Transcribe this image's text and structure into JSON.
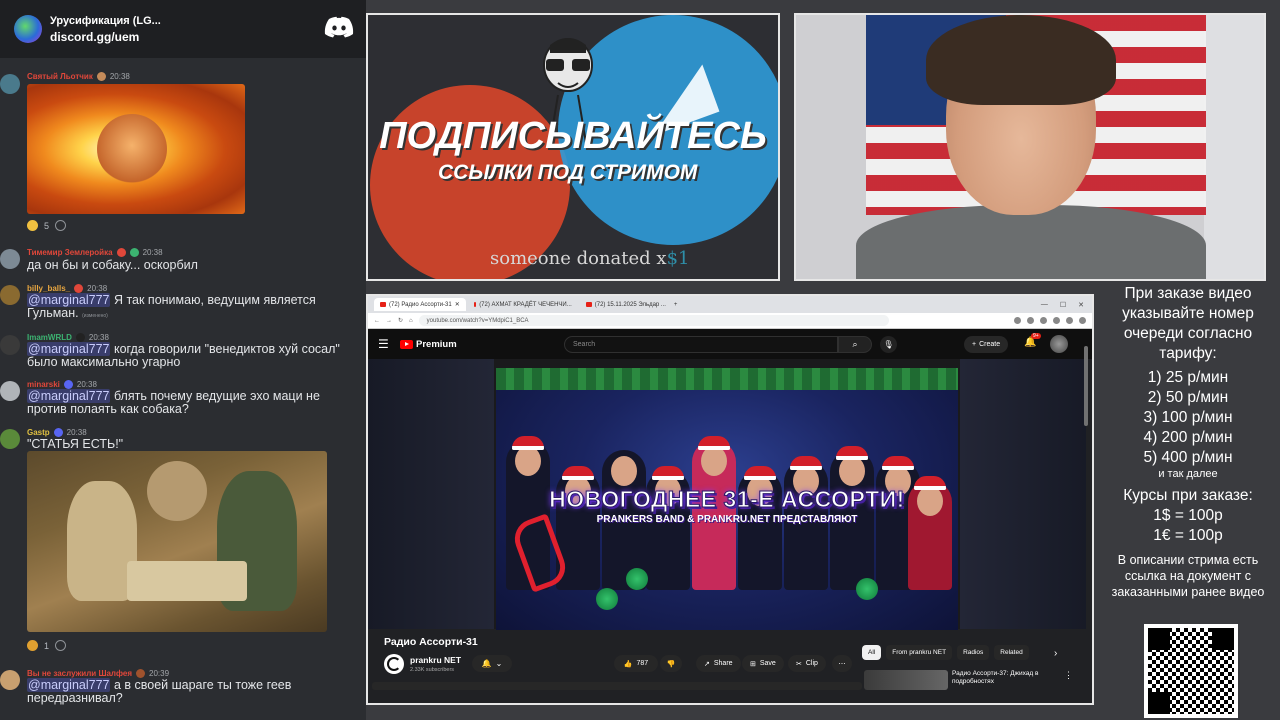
{
  "chat": {
    "server_name": "Урусификация (LG...",
    "invite": "discord.gg/uem",
    "messages": [
      {
        "user": "Святый Льотчик",
        "time": "20:38",
        "user_color": "#e0473a",
        "reactions": [
          {
            "count": "5"
          }
        ]
      },
      {
        "user": "Тимемир Землеройка",
        "time": "20:38",
        "user_color": "#e0473a",
        "text": "да он бы и собаку... оскорбил"
      },
      {
        "user": "billy_balls_",
        "time": "20:38",
        "user_color": "#e8a640",
        "mention": "@marginal777",
        "text": " Я так понимаю, ведущим является Гульман.",
        "note": "(изменено)"
      },
      {
        "user": "ImamWRLD",
        "time": "20:38",
        "user_color": "#3cb371",
        "mention": "@marginal777",
        "text": " когда говорили \"венедиктов хуй сосал\" было максимально угарно"
      },
      {
        "user": "minarski",
        "time": "20:38",
        "user_color": "#e0473a",
        "mention": "@marginal777",
        "text": " блять почему ведущие эхо маци не против полаять как собака?"
      },
      {
        "user": "Gastp",
        "time": "20:38",
        "user_color": "#e0c040",
        "text": "\"СТАТЬЯ ЕСТЬ!\"",
        "reactions": [
          {
            "count": "1"
          }
        ]
      },
      {
        "user": "Вы не заслужили Шалфея",
        "time": "20:39",
        "user_color": "#e0473a",
        "mention": "@marginal777",
        "text": " а в своей шараге ты тоже геев передразнивал?"
      }
    ]
  },
  "promo": {
    "title": "ПОДПИСЫВАЙТЕСЬ",
    "subtitle": "ССЫЛКИ ПОД СТРИМОМ",
    "donate_prefix": "someone donated x",
    "donate_amount": "$1"
  },
  "browser": {
    "tabs": [
      "(72) Радио Ассорти-31",
      "(72) АХМАТ КРАДЁТ ЧЕЧЕНЧИ...",
      "(72) 15.11.2025 Эльдар ..."
    ],
    "url": "youtube.com/watch?v=YMdpiC1_BCA"
  },
  "youtube": {
    "logo_text": "Premium",
    "search_placeholder": "Search",
    "create_label": "Create",
    "notif_count": "9+",
    "thumb_title": "НОВОГОДНЕЕ 31-Е АССОРТИ!",
    "thumb_subtitle": "PRANKERS BAND & PRANKRU.NET ПРЕДСТАВЛЯЮТ",
    "video_title": "Радио Ассорти-31",
    "channel_name": "prankru NET",
    "channel_subs": "2.33K subscribers",
    "like_count": "787",
    "share_label": "Share",
    "save_label": "Save",
    "clip_label": "Clip",
    "chips": [
      "All",
      "From prankru NET",
      "Radios",
      "Related"
    ],
    "rec_title": "Радио Ассорти-37: Джихад в подробностях"
  },
  "info": {
    "intro": "При заказе видео указывайте номер очереди согласно тарифу:",
    "prices": [
      "1) 25 р/мин",
      "2) 50 р/мин",
      "3) 100 р/мин",
      "4) 200 р/мин",
      "5) 400 р/мин"
    ],
    "etc": "и так далее",
    "rates_title": "Курсы при заказе:",
    "rates": [
      "1$ = 100р",
      "1€ = 100р"
    ],
    "description": "В описании стрима есть ссылка на документ с заказанными ранее видео"
  },
  "colors": {
    "discord_bg": "#2b2d31",
    "mention": "#c9cdfb",
    "youtube_red": "#ff0000",
    "page_bg": "#3a3b3f"
  }
}
